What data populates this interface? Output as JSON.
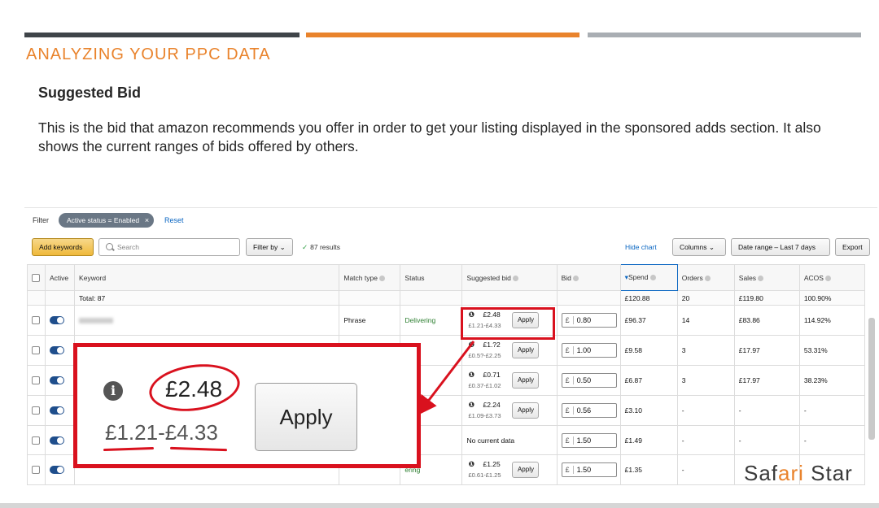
{
  "slide": {
    "title": "ANALYZING YOUR PPC DATA",
    "subtitle": "Suggested Bid",
    "body": "This is the bid that amazon recommends you offer in order to get your listing displayed in the sponsored adds section. It also shows the current ranges of bids offered by others.",
    "logo": {
      "part1": "Saf",
      "part2": "ari",
      "part3": " Star"
    }
  },
  "screenshot": {
    "filter": {
      "label": "Filter",
      "chip": "Active status = Enabled",
      "chip_close": "×",
      "reset": "Reset"
    },
    "toolbar": {
      "add_keywords": "Add keywords",
      "search_placeholder": "Search",
      "filter_by": "Filter by ⌄",
      "results": "87 results",
      "hide_chart": "Hide chart",
      "columns": "Columns ⌄",
      "date_range": "Date range – Last 7 days",
      "export": "Export"
    },
    "columns": {
      "active": "Active",
      "keyword": "Keyword",
      "match_type": "Match type",
      "status": "Status",
      "suggested_bid": "Suggested bid",
      "bid": "Bid",
      "spend": "Spend",
      "orders": "Orders",
      "sales": "Sales",
      "acos": "ACOS"
    },
    "total": {
      "label": "Total: 87",
      "spend": "£120.88",
      "orders": "20",
      "sales": "£119.80",
      "acos": "100.90%"
    },
    "rows": [
      {
        "match": "Phrase",
        "status": "Delivering",
        "sb_price": "£2.48",
        "sb_range": "£1.21-£4.33",
        "apply": "Apply",
        "bid_cur": "£",
        "bid": "0.80",
        "spend": "£96.37",
        "orders": "14",
        "sales": "£83.86",
        "acos": "114.92%"
      },
      {
        "match": "",
        "status": "ering",
        "sb_price": "£1.?2",
        "sb_range": "£0.5?-£2.25",
        "apply": "Apply",
        "bid_cur": "£",
        "bid": "1.00",
        "spend": "£9.58",
        "orders": "3",
        "sales": "£17.97",
        "acos": "53.31%"
      },
      {
        "match": "",
        "status": "ering",
        "sb_price": "£0.71",
        "sb_range": "£0.37-£1.02",
        "apply": "Apply",
        "bid_cur": "£",
        "bid": "0.50",
        "spend": "£6.87",
        "orders": "3",
        "sales": "£17.97",
        "acos": "38.23%"
      },
      {
        "match": "",
        "status": "ring",
        "sb_price": "£2.24",
        "sb_range": "£1.09-£3.73",
        "apply": "Apply",
        "bid_cur": "£",
        "bid": "0.56",
        "spend": "£3.10",
        "orders": "-",
        "sales": "-",
        "acos": "-"
      },
      {
        "match": "",
        "status": "ering",
        "sb_none": "No current data",
        "bid_cur": "£",
        "bid": "1.50",
        "spend": "£1.49",
        "orders": "-",
        "sales": "-",
        "acos": "-"
      },
      {
        "match": "",
        "status": "ering",
        "sb_price": "£1.25",
        "sb_range": "£0.61-£1.25",
        "apply": "Apply",
        "bid_cur": "£",
        "bid": "1.50",
        "spend": "£1.35",
        "orders": "-",
        "sales": "",
        "acos": ""
      }
    ],
    "zoom": {
      "info": "i",
      "price": "£2.48",
      "range": "£1.21-£4.33",
      "apply": "Apply"
    }
  },
  "colors": {
    "accent_orange": "#e9832c",
    "callout_red": "#d9111e",
    "bar_dark": "#3f4449",
    "bar_gray": "#a9aeb3"
  }
}
